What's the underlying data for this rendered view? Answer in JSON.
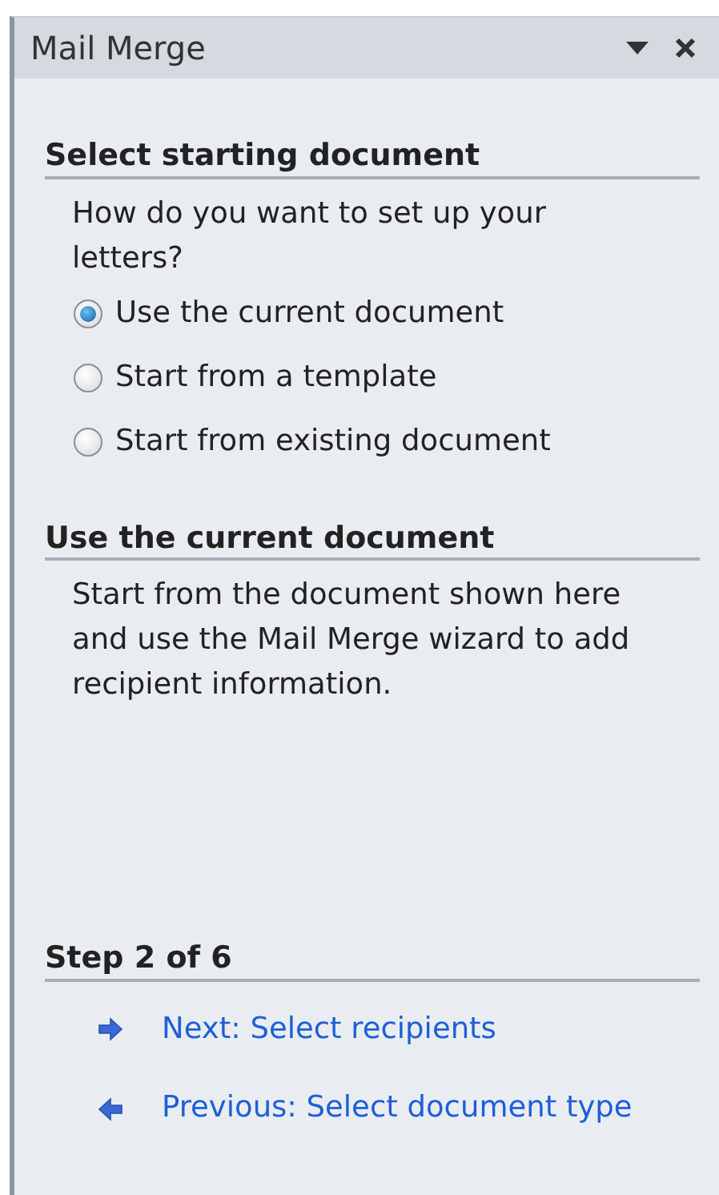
{
  "pane": {
    "title": "Mail Merge"
  },
  "select_section": {
    "heading": "Select starting document",
    "question": "How do you want to set up your letters?",
    "options": [
      {
        "label": "Use the current document",
        "selected": true
      },
      {
        "label": "Start from a template",
        "selected": false
      },
      {
        "label": "Start from existing document",
        "selected": false
      }
    ]
  },
  "info_section": {
    "heading": "Use the current document",
    "body": "Start from the document shown here and use the Mail Merge wizard to add recipient information."
  },
  "step_section": {
    "heading": "Step 2 of 6",
    "links": [
      {
        "kind": "next",
        "label": "Next: Select recipients"
      },
      {
        "kind": "previous",
        "label": "Previous: Select document type"
      }
    ]
  }
}
